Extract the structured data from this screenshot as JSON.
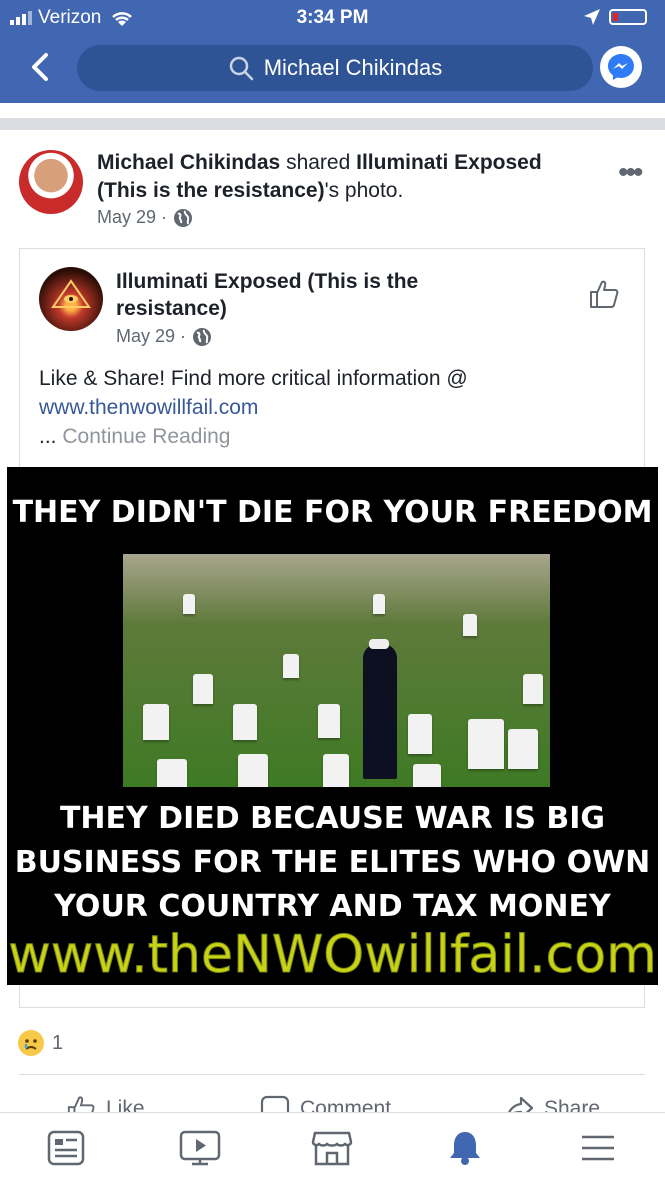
{
  "status_bar": {
    "carrier": "Verizon",
    "time": "3:34 PM"
  },
  "search": {
    "query": "Michael Chikindas"
  },
  "post": {
    "author": "Michael Chikindas",
    "action_text": "shared",
    "shared_from": "Illuminati Exposed (This is the resistance)",
    "suffix": "'s photo.",
    "date": "May 29 ·"
  },
  "shared_post": {
    "page_name": "Illuminati Exposed (This is the resistance)",
    "date": "May 29 ·",
    "text": "Like & Share! Find more critical information @",
    "link": "www.thenwowillfail.com",
    "continue_prefix": "...",
    "continue_label": "Continue Reading"
  },
  "image": {
    "top_text": "THEY DIDN'T DIE FOR YOUR FREEDOM",
    "bottom_line1": "THEY DIED BECAUSE WAR IS BIG",
    "bottom_line2": "BUSINESS FOR THE ELITES WHO OWN",
    "bottom_line3": "YOUR COUNTRY AND TAX MONEY",
    "url": "www.theNWOwillfail.com"
  },
  "reactions": {
    "count": "1"
  },
  "actions": {
    "like": "Like",
    "comment": "Comment",
    "share": "Share"
  },
  "icons": [
    "back-icon",
    "search-icon",
    "messenger-icon",
    "globe-icon",
    "more-icon",
    "like-page-icon",
    "sad-reaction-icon",
    "news-feed-icon",
    "watch-icon",
    "marketplace-icon",
    "notifications-icon",
    "menu-icon"
  ],
  "colors": {
    "header": "#4267b2",
    "link": "#385898",
    "active_tab": "#4267b2"
  }
}
